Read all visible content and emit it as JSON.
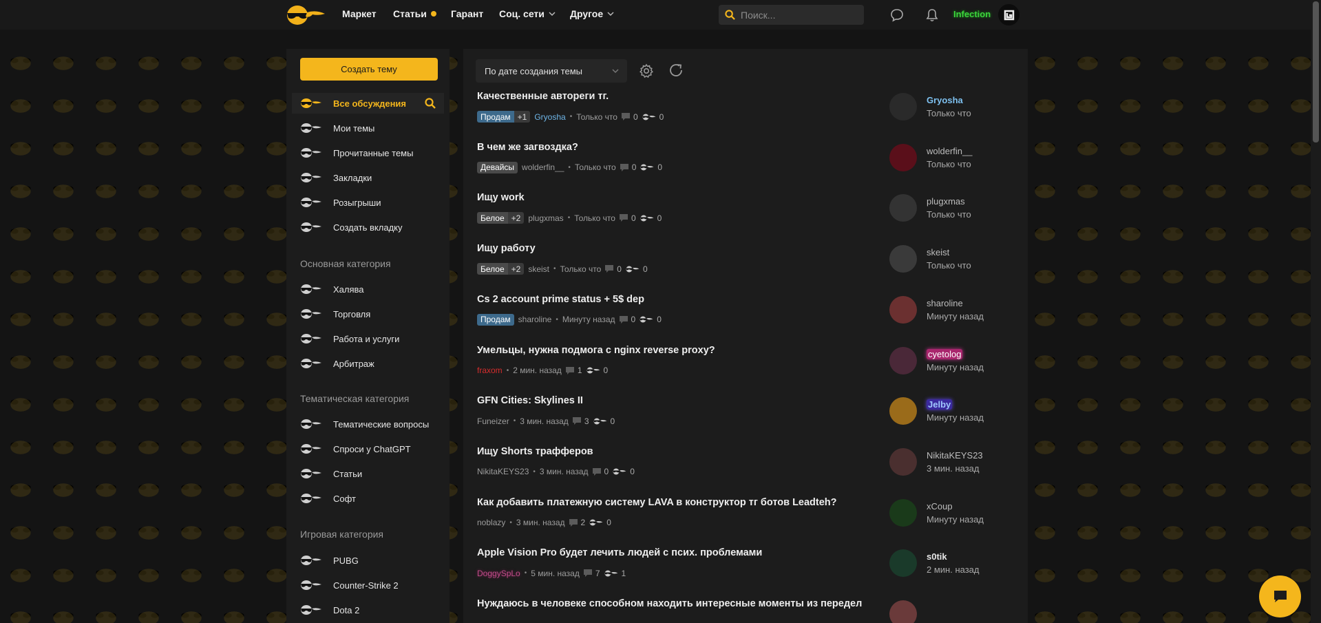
{
  "header": {
    "logo": "sunglasses-smiley-logo",
    "nav": [
      {
        "label": "Маркет"
      },
      {
        "label": "Статьи",
        "has_dot": true
      },
      {
        "label": "Гарант"
      },
      {
        "label": "Соц. сети",
        "dropdown": true
      },
      {
        "label": "Другое",
        "dropdown": true
      }
    ],
    "search_placeholder": "Поиск...",
    "username": "Infection",
    "accent": "#f4b61c"
  },
  "sidebar": {
    "create_button": "Создать тему",
    "items": [
      {
        "label": "Все обсуждения",
        "active": true
      },
      {
        "label": "Мои темы"
      },
      {
        "label": "Прочитанные темы"
      },
      {
        "label": "Закладки"
      },
      {
        "label": "Розыгрыши"
      },
      {
        "label": "Создать вкладку"
      }
    ],
    "categories": [
      {
        "title": "Основная категория",
        "items": [
          {
            "label": "Халява"
          },
          {
            "label": "Торговля"
          },
          {
            "label": "Работа и услуги"
          },
          {
            "label": "Арбитраж"
          }
        ]
      },
      {
        "title": "Тематическая категория",
        "items": [
          {
            "label": "Тематические вопросы"
          },
          {
            "label": "Спроси у ChatGPT"
          },
          {
            "label": "Статьи"
          },
          {
            "label": "Софт"
          }
        ]
      },
      {
        "title": "Игровая категория",
        "items": [
          {
            "label": "PUBG"
          },
          {
            "label": "Counter-Strike 2"
          },
          {
            "label": "Dota 2"
          }
        ]
      }
    ]
  },
  "main": {
    "sort_label": "По дате создания темы",
    "threads": [
      {
        "title": "Качественные автореги тг.",
        "tag": "Продам",
        "tag_style": "blue",
        "tag_plus": "+1",
        "author": "Gryosha",
        "author_style": "blue",
        "time": "Только что",
        "replies": "0",
        "likes": "0",
        "last_user": "Gryosha",
        "last_user_style": "blue",
        "last_time": "Только что"
      },
      {
        "title": "В чем же загвоздка?",
        "tag": "Девайсы",
        "tag_style": "gray",
        "tag_plus": "",
        "author": "wolderfin__",
        "author_style": "",
        "time": "Только что",
        "replies": "0",
        "likes": "0",
        "last_user": "wolderfin__",
        "last_user_style": "",
        "last_time": "Только что"
      },
      {
        "title": "Ищу work",
        "tag": "Белое",
        "tag_style": "gray",
        "tag_plus": "+2",
        "author": "plugxmas",
        "author_style": "",
        "time": "Только что",
        "replies": "0",
        "likes": "0",
        "last_user": "plugxmas",
        "last_user_style": "",
        "last_time": "Только что"
      },
      {
        "title": "Ищу работу",
        "tag": "Белое",
        "tag_style": "gray",
        "tag_plus": "+2",
        "author": "skeist",
        "author_style": "",
        "time": "Только что",
        "replies": "0",
        "likes": "0",
        "last_user": "skeist",
        "last_user_style": "",
        "last_time": "Только что"
      },
      {
        "title": "Cs 2 account prime status + 5$ dep",
        "tag": "Продам",
        "tag_style": "blue",
        "tag_plus": "",
        "author": "sharoline",
        "author_style": "",
        "time": "Минуту назад",
        "replies": "0",
        "likes": "0",
        "last_user": "sharoline",
        "last_user_style": "",
        "last_time": "Минуту назад"
      },
      {
        "title": "Умельцы, нужна подмога с nginx reverse proxy?",
        "tag": "",
        "tag_style": "",
        "tag_plus": "",
        "author": "fraxom",
        "author_style": "red",
        "time": "2 мин. назад",
        "replies": "1",
        "likes": "0",
        "last_user": "cyetolog",
        "last_user_style": "pink",
        "last_time": "Минуту назад"
      },
      {
        "title": "GFN Cities: Skylines II",
        "tag": "",
        "tag_style": "",
        "tag_plus": "",
        "author": "Funeizer",
        "author_style": "",
        "time": "3 мин. назад",
        "replies": "3",
        "likes": "0",
        "last_user": "Jelby",
        "last_user_style": "violet",
        "last_time": "Минуту назад"
      },
      {
        "title": "Ищу Shorts трафферов",
        "tag": "",
        "tag_style": "",
        "tag_plus": "",
        "author": "NikitaKEYS23",
        "author_style": "",
        "time": "3 мин. назад",
        "replies": "0",
        "likes": "0",
        "last_user": "NikitaKEYS23",
        "last_user_style": "",
        "last_time": "3 мин. назад"
      },
      {
        "title": "Как добавить платежную систему LAVA в конструктор тг ботов Leadteh?",
        "tag": "",
        "tag_style": "",
        "tag_plus": "",
        "author": "noblazy",
        "author_style": "",
        "time": "3 мин. назад",
        "replies": "2",
        "likes": "0",
        "last_user": "xCoup",
        "last_user_style": "",
        "last_time": "Минуту назад"
      },
      {
        "title": "Apple Vision Pro будет лечить людей с псих. проблемами",
        "tag": "",
        "tag_style": "",
        "tag_plus": "",
        "author": "DoggySpLo",
        "author_style": "pink",
        "time": "5 мин. назад",
        "replies": "7",
        "likes": "1",
        "last_user": "s0tik",
        "last_user_style": "white",
        "last_time": "2 мин. назад"
      },
      {
        "title": "Нуждаюсь в человеке способном находить интересные моменты из передел",
        "tag": "",
        "tag_style": "",
        "tag_plus": "",
        "author": "",
        "author_style": "",
        "time": "",
        "replies": "",
        "likes": "",
        "last_user": "",
        "last_user_style": "",
        "last_time": ""
      }
    ]
  }
}
